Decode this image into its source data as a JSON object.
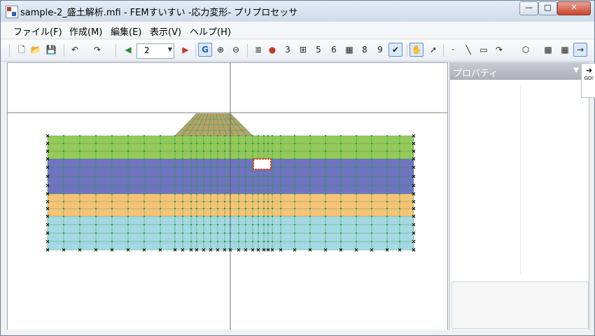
{
  "window": {
    "title": "sample-2_盛土解析.mfi - FEMすいすい -応力変形- プリプロセッサ",
    "controls": {
      "minimize": "—",
      "maximize": "□",
      "close": "✕"
    }
  },
  "menu": [
    "ファイル(F)",
    "作成(M)",
    "編集(E)",
    "表示(V)",
    "ヘルプ(H)"
  ],
  "toolbar": {
    "combo_value": "2",
    "buttons": [
      {
        "name": "new-icon",
        "glyph": "🗋"
      },
      {
        "name": "open-icon",
        "glyph": "📂"
      },
      {
        "name": "save-icon",
        "glyph": "💾"
      },
      {
        "name": "undo-icon",
        "glyph": "↶"
      },
      {
        "name": "redo-icon",
        "glyph": "↷"
      },
      {
        "name": "prev-step-icon",
        "glyph": "◀"
      },
      {
        "name": "add-step-icon",
        "glyph": "▶"
      },
      {
        "name": "g-icon",
        "glyph": "G"
      },
      {
        "name": "zoom-in-icon",
        "glyph": "⊕"
      },
      {
        "name": "zoom-out-icon",
        "glyph": "⊖"
      },
      {
        "name": "list-icon",
        "glyph": "≣"
      },
      {
        "name": "material-icon",
        "glyph": "●"
      },
      {
        "name": "dimension-icon",
        "glyph": "3"
      },
      {
        "name": "boundary-icon",
        "glyph": "⊞"
      },
      {
        "name": "number-icon",
        "glyph": "5"
      },
      {
        "name": "load-icon",
        "glyph": "6"
      },
      {
        "name": "grid-icon",
        "glyph": "▦"
      },
      {
        "name": "table-icon",
        "glyph": "8"
      },
      {
        "name": "check-icon",
        "glyph": "9"
      },
      {
        "name": "validate-icon",
        "glyph": "✔"
      },
      {
        "name": "hand-icon",
        "glyph": "✋"
      },
      {
        "name": "pointer-icon",
        "glyph": "➚"
      },
      {
        "name": "point-icon",
        "glyph": "·"
      },
      {
        "name": "line-icon",
        "glyph": "╲"
      },
      {
        "name": "rect-icon",
        "glyph": "▭"
      },
      {
        "name": "arc-icon",
        "glyph": "↷"
      },
      {
        "name": "polygon-icon",
        "glyph": "⬡"
      },
      {
        "name": "fill-icon",
        "glyph": "▩"
      },
      {
        "name": "mesh-icon",
        "glyph": "▦"
      },
      {
        "name": "go-icon",
        "glyph": "→"
      }
    ]
  },
  "properties": {
    "title": "プロパティ"
  },
  "go_button": {
    "label": "GO!"
  },
  "colors": {
    "embankment": "#b6a26a",
    "layer1": "#95c95a",
    "layer2": "#6f74c0",
    "layer3": "#f7c477",
    "layer4": "#a4d9e3",
    "mesh": "#2e9a4b",
    "opening_border": "#d0452a"
  }
}
